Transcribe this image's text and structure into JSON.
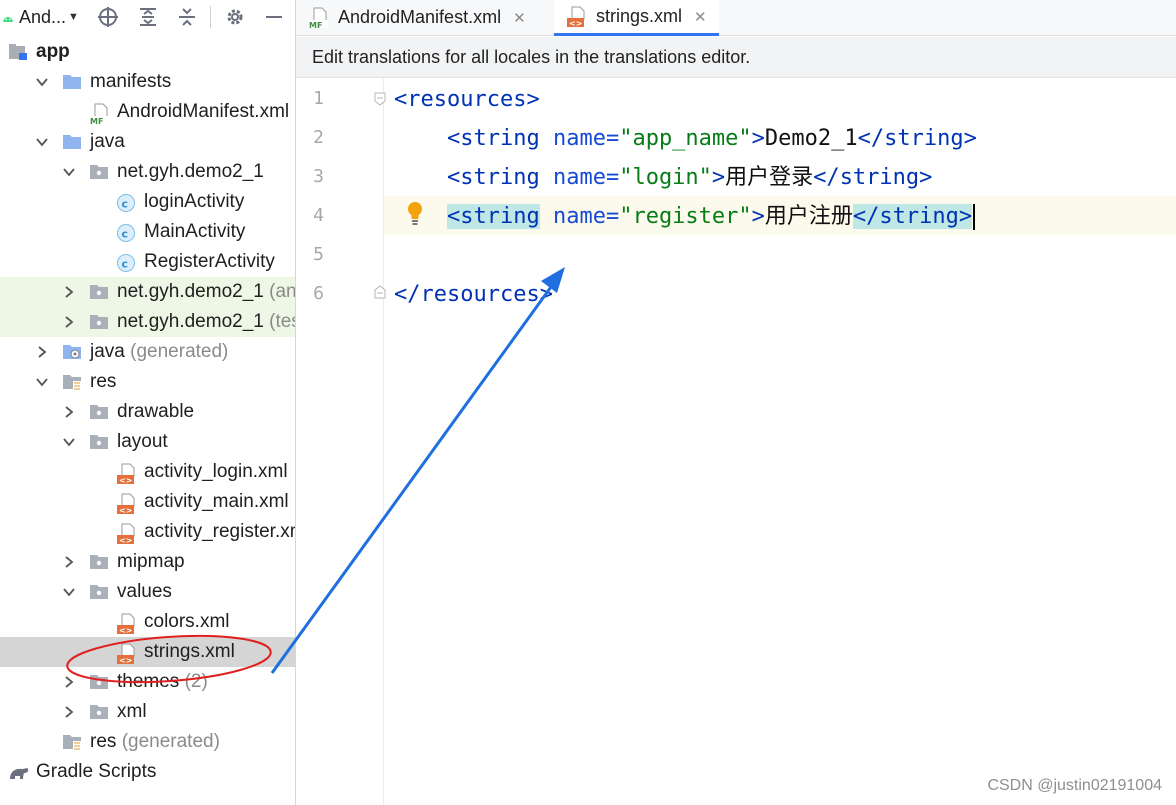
{
  "project_toolbar": {
    "view_label": "And...",
    "icons": [
      "android-icon",
      "dropdown-caret-icon",
      "locate-icon",
      "expand-all-icon",
      "collapse-all-icon",
      "settings-icon",
      "hide-icon"
    ]
  },
  "tree": [
    {
      "label": "app",
      "icon": "module-icon",
      "arrow": "none",
      "bold": true
    },
    {
      "label": "manifests",
      "icon": "folder-icon",
      "arrow": "down"
    },
    {
      "label": "AndroidManifest.xml",
      "icon": "manifest-file-icon",
      "arrow": "none"
    },
    {
      "label": "java",
      "icon": "folder-icon",
      "arrow": "down"
    },
    {
      "label": "net.gyh.demo2_1",
      "icon": "package-icon",
      "arrow": "down"
    },
    {
      "label": "loginActivity",
      "icon": "class-icon",
      "arrow": "none"
    },
    {
      "label": "MainActivity",
      "icon": "class-icon",
      "arrow": "none"
    },
    {
      "label": "RegisterActivity",
      "icon": "class-icon",
      "arrow": "none"
    },
    {
      "label": "net.gyh.demo2_1",
      "suffix": "(andro",
      "icon": "package-icon",
      "arrow": "right",
      "tint": true
    },
    {
      "label": "net.gyh.demo2_1",
      "suffix": "(test)",
      "icon": "package-icon",
      "arrow": "right",
      "tint": true
    },
    {
      "label": "java",
      "suffix": "(generated)",
      "icon": "generated-folder-icon",
      "arrow": "right"
    },
    {
      "label": "res",
      "icon": "res-folder-icon",
      "arrow": "down"
    },
    {
      "label": "drawable",
      "icon": "package-icon",
      "arrow": "right"
    },
    {
      "label": "layout",
      "icon": "package-icon",
      "arrow": "down"
    },
    {
      "label": "activity_login.xml",
      "icon": "xml-file-icon",
      "arrow": "none"
    },
    {
      "label": "activity_main.xml",
      "icon": "xml-file-icon",
      "arrow": "none"
    },
    {
      "label": "activity_register.xml",
      "icon": "xml-file-icon",
      "arrow": "none"
    },
    {
      "label": "mipmap",
      "icon": "package-icon",
      "arrow": "right"
    },
    {
      "label": "values",
      "icon": "package-icon",
      "arrow": "down"
    },
    {
      "label": "colors.xml",
      "icon": "xml-file-icon",
      "arrow": "none"
    },
    {
      "label": "strings.xml",
      "icon": "xml-file-icon",
      "arrow": "none",
      "selected": true
    },
    {
      "label": "themes",
      "suffix": "(2)",
      "icon": "package-icon",
      "arrow": "right"
    },
    {
      "label": "xml",
      "icon": "package-icon",
      "arrow": "right"
    },
    {
      "label": "res",
      "suffix": "(generated)",
      "icon": "res-folder-icon",
      "arrow": "none"
    },
    {
      "label": "Gradle Scripts",
      "icon": "gradle-icon",
      "arrow": "none"
    }
  ],
  "tabs": [
    {
      "label": "AndroidManifest.xml",
      "icon": "manifest-file-icon",
      "close": "✕"
    },
    {
      "label": "strings.xml",
      "icon": "xml-file-icon",
      "close": "✕",
      "active": true
    }
  ],
  "banner": "Edit translations for all locales in the translations editor.",
  "editor": {
    "line_numbers": [
      "1",
      "2",
      "3",
      "4",
      "5",
      "6"
    ],
    "lines": {
      "l1": {
        "open": "<",
        "tag": "resources",
        "close": ">"
      },
      "l2": {
        "open": "<",
        "tag": "string",
        "attr": "name=",
        "val": "\"app_name\"",
        "mid": ">",
        "text": "Demo2_1",
        "end_open": "</",
        "end_tag": "string",
        "end_close": ">"
      },
      "l3": {
        "open": "<",
        "tag": "string",
        "attr": "name=",
        "val": "\"login\"",
        "mid": ">",
        "text": "用户登录",
        "end_open": "</",
        "end_tag": "string",
        "end_close": ">"
      },
      "l4": {
        "open": "<",
        "tag": "string",
        "attr": "name=",
        "val": "\"register\"",
        "mid": ">",
        "text": "用户注册",
        "end_open": "</",
        "end_tag": "string",
        "end_close": ">"
      },
      "l6": {
        "open": "</",
        "tag": "resources",
        "close": ">"
      }
    },
    "current_line": 4,
    "intention_icon": "lightbulb-icon"
  },
  "annotation": {
    "color": "#1f6fe0",
    "circle_color": "#e02020"
  },
  "watermark": "CSDN @justin02191004"
}
